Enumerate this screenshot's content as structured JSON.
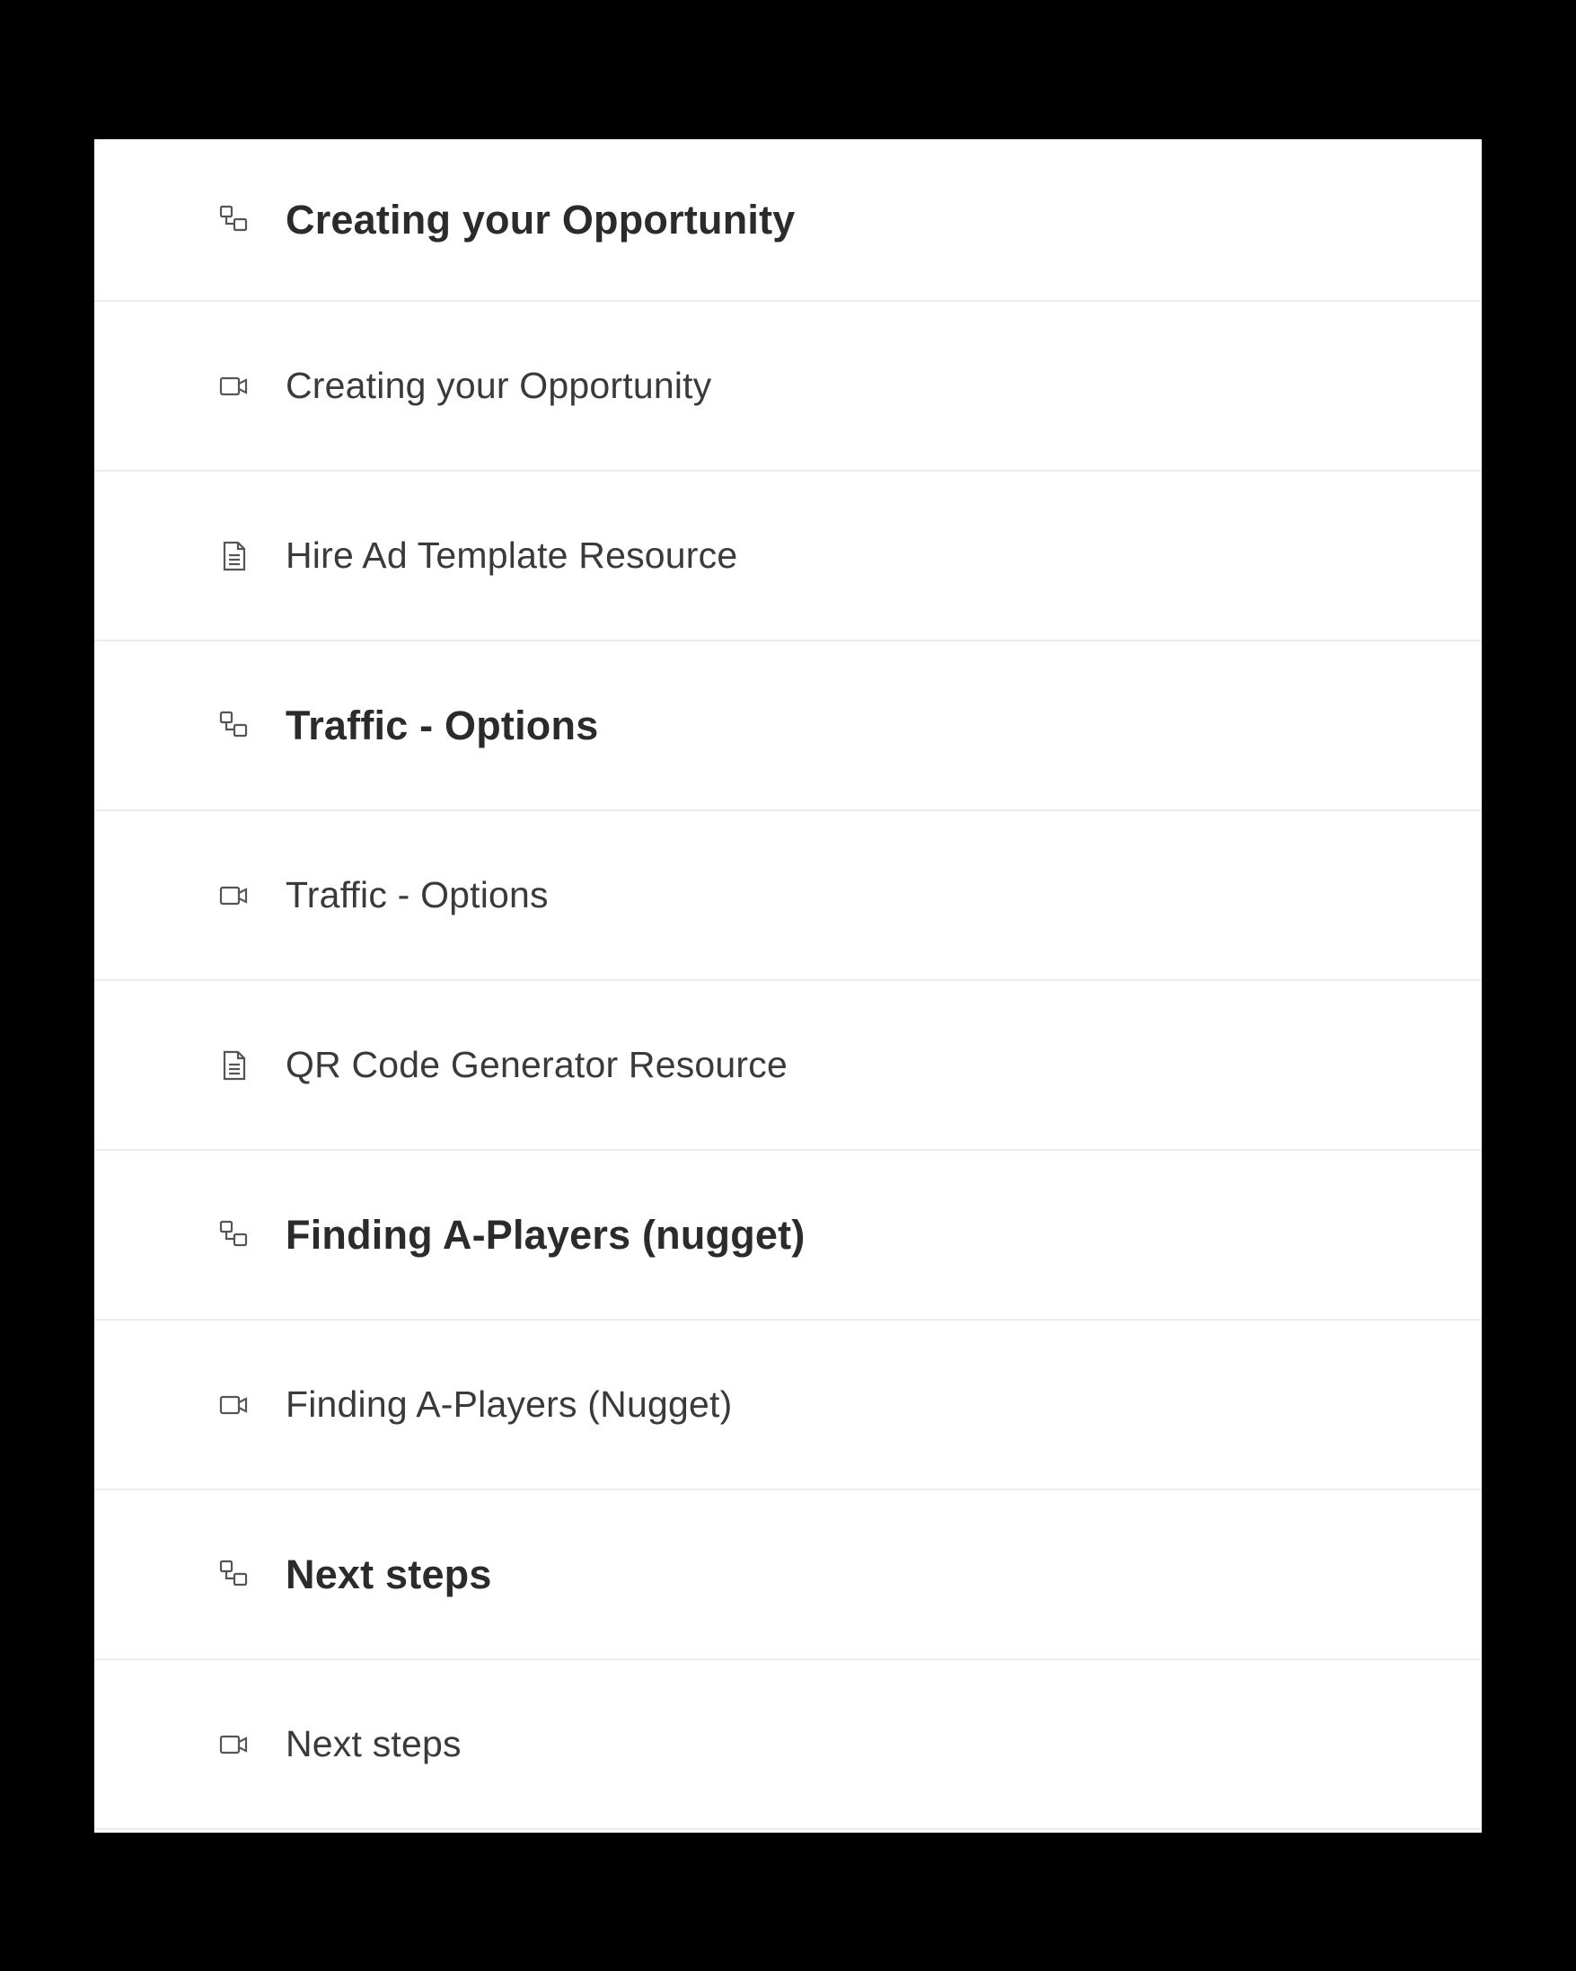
{
  "curriculum": {
    "items": [
      {
        "kind": "section",
        "icon": "module-icon",
        "label": "Creating your Opportunity"
      },
      {
        "kind": "lesson",
        "icon": "video-icon",
        "label": "Creating your Opportunity"
      },
      {
        "kind": "lesson",
        "icon": "document-icon",
        "label": "Hire Ad Template Resource"
      },
      {
        "kind": "section",
        "icon": "module-icon",
        "label": "Traffic - Options"
      },
      {
        "kind": "lesson",
        "icon": "video-icon",
        "label": "Traffic - Options"
      },
      {
        "kind": "lesson",
        "icon": "document-icon",
        "label": "QR Code Generator Resource"
      },
      {
        "kind": "section",
        "icon": "module-icon",
        "label": "Finding A-Players (nugget)"
      },
      {
        "kind": "lesson",
        "icon": "video-icon",
        "label": "Finding A-Players (Nugget)"
      },
      {
        "kind": "section",
        "icon": "module-icon",
        "label": "Next steps"
      },
      {
        "kind": "lesson",
        "icon": "video-icon",
        "label": "Next steps"
      }
    ]
  },
  "colors": {
    "page_background": "#000000",
    "panel_background": "#ffffff",
    "divider": "#ececec",
    "text": "#3a3a3a",
    "icon": "#555555"
  }
}
